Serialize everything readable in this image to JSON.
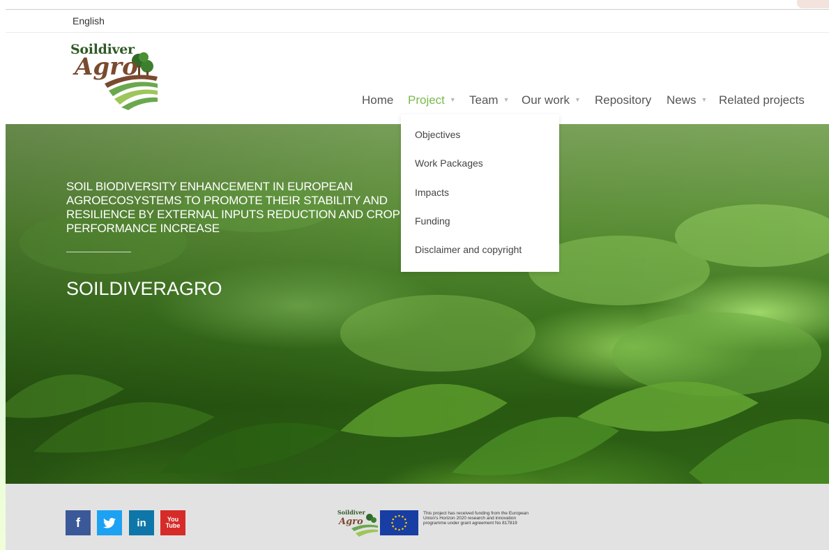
{
  "language": {
    "label": "English"
  },
  "logo": {
    "line1": "Soildiver",
    "line2": "Agro"
  },
  "nav": {
    "items": [
      {
        "label": "Home",
        "has_dropdown": false,
        "active": false
      },
      {
        "label": "Project",
        "has_dropdown": true,
        "active": true
      },
      {
        "label": "Team",
        "has_dropdown": true,
        "active": false
      },
      {
        "label": "Our work",
        "has_dropdown": true,
        "active": false
      },
      {
        "label": "Repository",
        "has_dropdown": false,
        "active": false
      },
      {
        "label": "News",
        "has_dropdown": true,
        "active": false
      },
      {
        "label": "Related projects",
        "has_dropdown": false,
        "active": false
      }
    ],
    "caret": "▼"
  },
  "dropdown": {
    "items": [
      "Objectives",
      "Work Packages",
      "Impacts",
      "Funding",
      "Disclaimer and copyright"
    ]
  },
  "hero": {
    "subtitle": "SOIL BIODIVERSITY ENHANCEMENT IN EUROPEAN AGROECOSYSTEMS TO PROMOTE THEIR STABILITY AND RESILIENCE BY EXTERNAL INPUTS REDUCTION AND CROP PERFORMANCE INCREASE",
    "title": "SOILDIVERAGRO"
  },
  "footer": {
    "social": {
      "facebook": "f",
      "twitter": "t",
      "linkedin": "in",
      "youtube_top": "You",
      "youtube_bottom": "Tube"
    },
    "funding_logo_line1": "Soildiver",
    "funding_logo_line2": "Agro",
    "funding_text": "This project has received funding from the European Union's Horizon 2020 research and innovation programme under grant agreement No 817819"
  },
  "colors": {
    "accent_green": "#78ba4a",
    "logo_green": "#2f5a26",
    "logo_brown": "#7a4a2e",
    "footer_bg": "#e2e2e2",
    "facebook": "#3b5998",
    "twitter": "#1da1f2",
    "linkedin": "#0e76a8",
    "youtube": "#d62b28",
    "eu_blue": "#183da3",
    "eu_star": "#ffcc00"
  },
  "icons": {
    "facebook": "facebook-icon",
    "twitter": "twitter-icon",
    "linkedin": "linkedin-icon",
    "youtube": "youtube-icon",
    "eu_flag": "eu-flag-icon",
    "caret": "caret-down-icon"
  }
}
